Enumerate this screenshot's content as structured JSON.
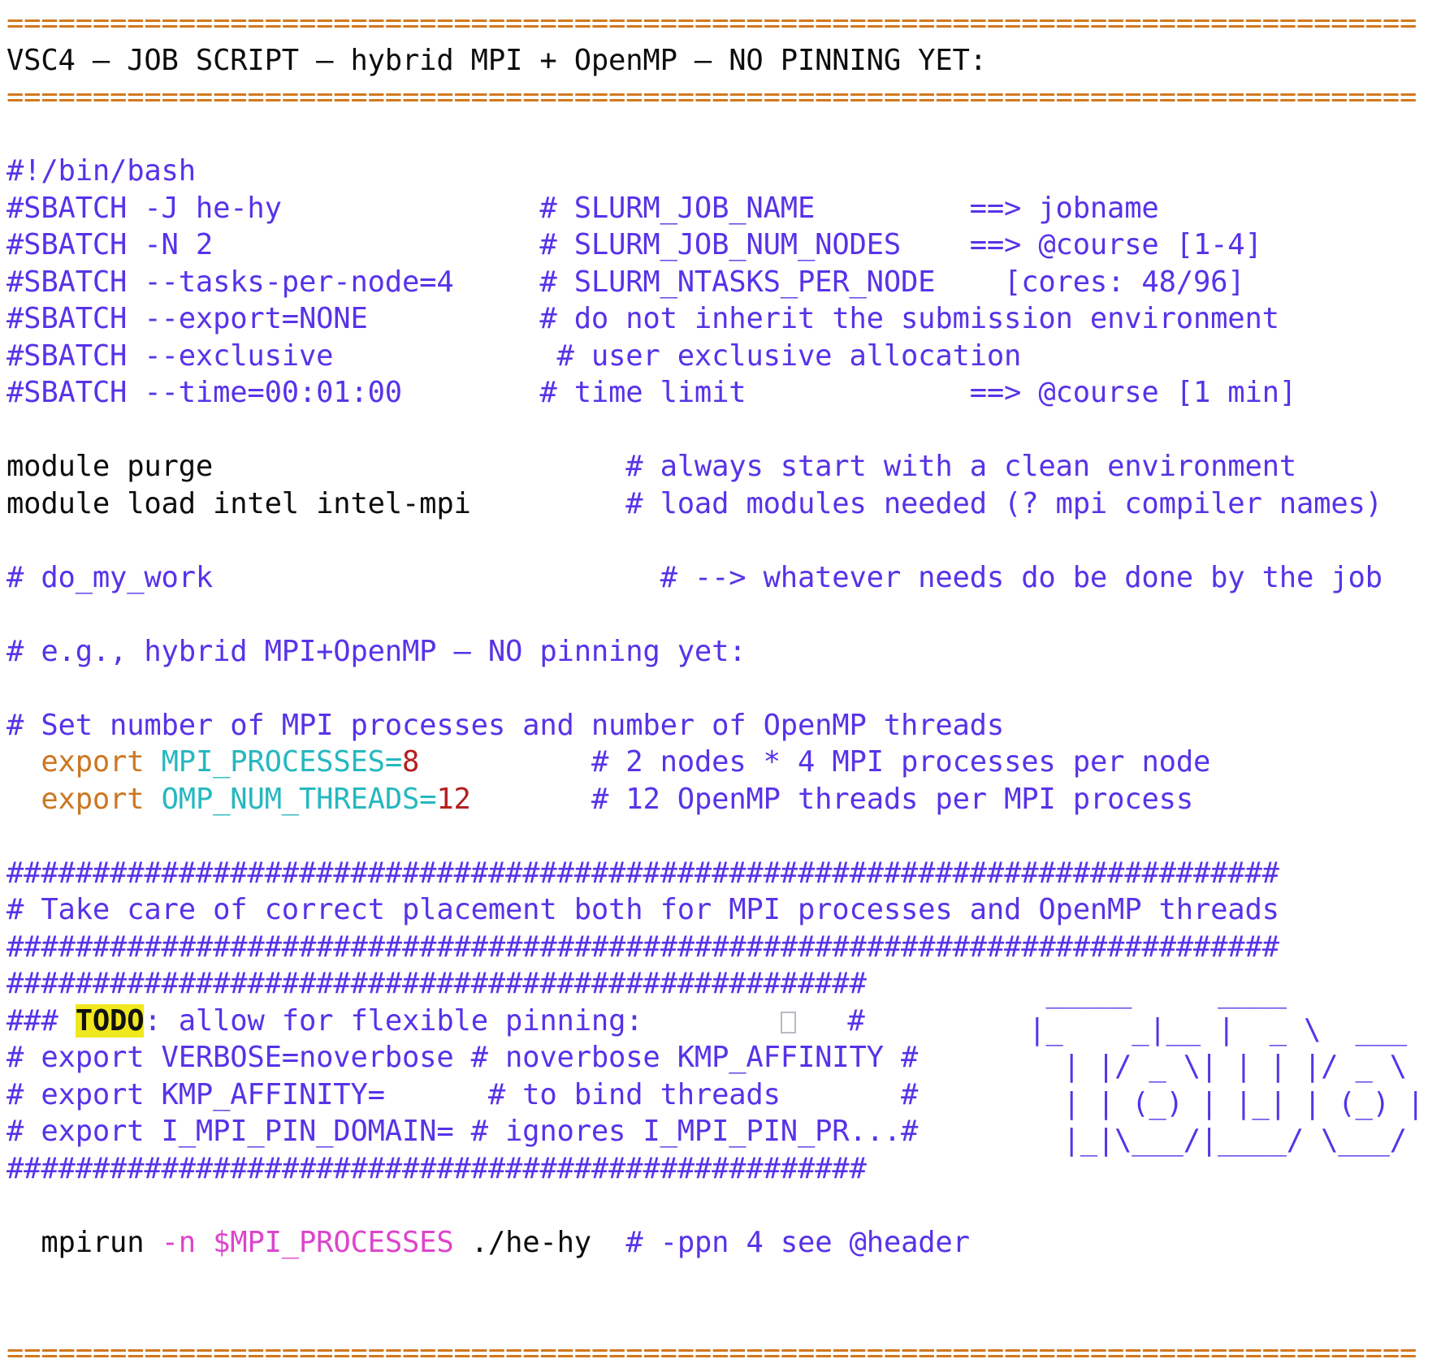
{
  "document": {
    "kind": "code-slide",
    "title": "VSC4 – JOB SCRIPT – hybrid MPI + OpenMP – NO PINNING YET:",
    "rule_char": "=",
    "top_rule": "==================================================================================",
    "bottom_rule": "==================================================================================",
    "hash_rule_long": "##########################################################################",
    "hash_rule_short": "##################################################",
    "colors": {
      "rule": "#D2781E",
      "title": "#0d0d0d",
      "comment": "#5733E8",
      "plain": "#0d0d0d",
      "keyword_export": "#CC7722",
      "variable": "#26B8BF",
      "number": "#B42020",
      "magenta": "#DD44CC",
      "todo_highlight_bg": "#F0E81E",
      "todo_highlight_fg": "#111111",
      "background": "#ffffff"
    }
  },
  "script": {
    "shebang": "#!/bin/bash",
    "sbatch": [
      {
        "code": "#SBATCH -J he-hy",
        "comment": "# SLURM_JOB_NAME         ==> jobname"
      },
      {
        "code": "#SBATCH -N 2",
        "comment": "# SLURM_JOB_NUM_NODES    ==> @course [1-4]"
      },
      {
        "code": "#SBATCH --tasks-per-node=4",
        "comment": "# SLURM_NTASKS_PER_NODE    [cores: 48/96]"
      },
      {
        "code": "#SBATCH --export=NONE",
        "comment": "# do not inherit the submission environment"
      },
      {
        "code": "#SBATCH --exclusive",
        "comment": "# user exclusive allocation"
      },
      {
        "code": "#SBATCH --time=00:01:00",
        "comment": "# time limit             ==> @course [1 min]"
      }
    ],
    "modules": [
      {
        "code": "module purge",
        "comment": "# always start with a clean environment"
      },
      {
        "code": "module load intel intel-mpi",
        "comment": "# load modules needed (? mpi compiler names)"
      }
    ],
    "work": {
      "code": "# do_my_work",
      "comment": "# --> whatever needs do be done by the job"
    },
    "example_note": "# e.g., hybrid MPI+OpenMP – NO pinning yet:",
    "set_numbers_note": "# Set number of MPI processes and number of OpenMP threads",
    "exports": [
      {
        "keyword": "export",
        "name": "MPI_PROCESSES=",
        "value": "8",
        "comment": "# 2 nodes * 4 MPI processes per node"
      },
      {
        "keyword": "export",
        "name": "OMP_NUM_THREADS=",
        "value": "12",
        "comment": "# 12 OpenMP threads per MPI process"
      }
    ],
    "placement_note": "# Take care of correct placement both for MPI processes and OpenMP threads",
    "todo": {
      "prefix": "### ",
      "tag": "TODO",
      "suffix": ": allow for flexible pinning:",
      "trailing_hash": "#"
    },
    "pinning_lines": [
      {
        "left": "# export VERBOSE=noverbose # noverbose KMP_AFFINITY ",
        "right": "#"
      },
      {
        "left": "# export KMP_AFFINITY=      # to bind threads       ",
        "right": "#"
      },
      {
        "left": "# export I_MPI_PIN_DOMAIN= # ignores I_MPI_PIN_PR...",
        "right": "#"
      }
    ],
    "mpirun": {
      "cmd": "mpirun",
      "args": "-n $MPI_PROCESSES",
      "binary": "./he-hy",
      "comment": "# -ppn 4 see @header"
    },
    "ascii_art": [
      "  _____     ____",
      " |_    _|__ |  _ \\  ___",
      "   | |/ _ \\| | | |/ _ \\",
      "   | | (_) | |_| | (_) |",
      "   |_|\\___/|____/ \\___/"
    ]
  }
}
